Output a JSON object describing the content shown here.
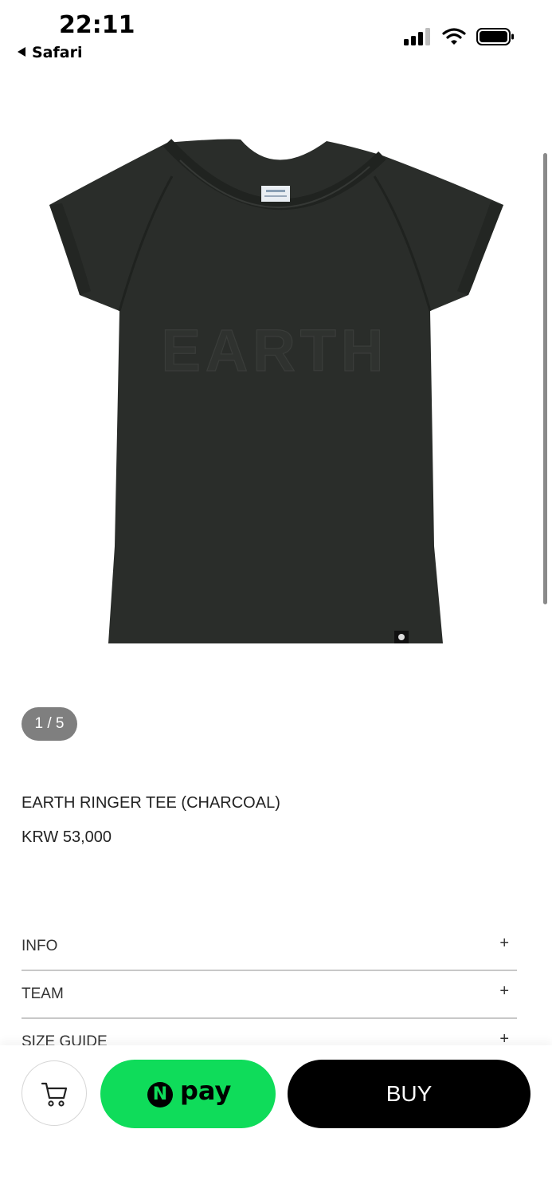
{
  "status_bar": {
    "time": "22:11",
    "back_app": "Safari",
    "icons": [
      "signal-icon",
      "wifi-icon",
      "battery-icon"
    ]
  },
  "gallery": {
    "image": "charcoal-tee-product-photo",
    "counter": "1 / 5"
  },
  "product": {
    "title": "EARTH RINGER TEE (CHARCOAL)",
    "price": "KRW 53,000"
  },
  "accordion": [
    {
      "label": "INFO",
      "icon": "+"
    },
    {
      "label": "TEAM",
      "icon": "+"
    },
    {
      "label": "SIZE GUIDE",
      "icon": "+"
    }
  ],
  "actions": {
    "cart_icon": "cart-icon",
    "npay_badge": "N",
    "npay_label": "pay",
    "buy_label": "BUY"
  },
  "colors": {
    "npay_green": "#0fdc5a",
    "buy_black": "#000000",
    "counter_bg": "#7f7f7f",
    "tee_charcoal": "#2a2d2a"
  }
}
